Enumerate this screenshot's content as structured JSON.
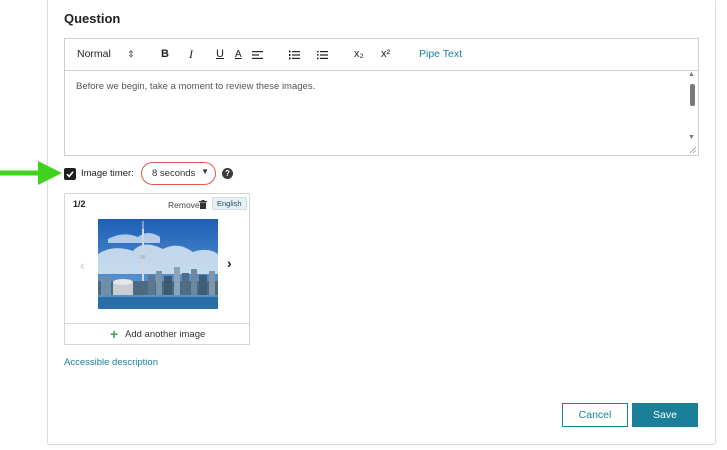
{
  "section": {
    "title": "Question"
  },
  "toolbar": {
    "style_select": "Normal",
    "bold": "B",
    "italic": "I",
    "underline": "U",
    "font_color": "A",
    "subscript": "x₂",
    "superscript": "x²",
    "pipe_text": "Pipe Text"
  },
  "editor": {
    "text": "Before we begin, take a moment to review these images."
  },
  "timer": {
    "label": "Image timer:",
    "checked": true,
    "value": "8 seconds"
  },
  "images": {
    "counter": "1/2",
    "remove_label": "Remove",
    "language": "English",
    "add_label": "Add another image"
  },
  "accessible_link": "Accessible description",
  "actions": {
    "cancel": "Cancel",
    "save": "Save"
  },
  "colors": {
    "accent": "#1a7f99",
    "timer_border": "#e05a4a",
    "arrow": "#3fd21f",
    "add_plus": "#3ba14c"
  }
}
